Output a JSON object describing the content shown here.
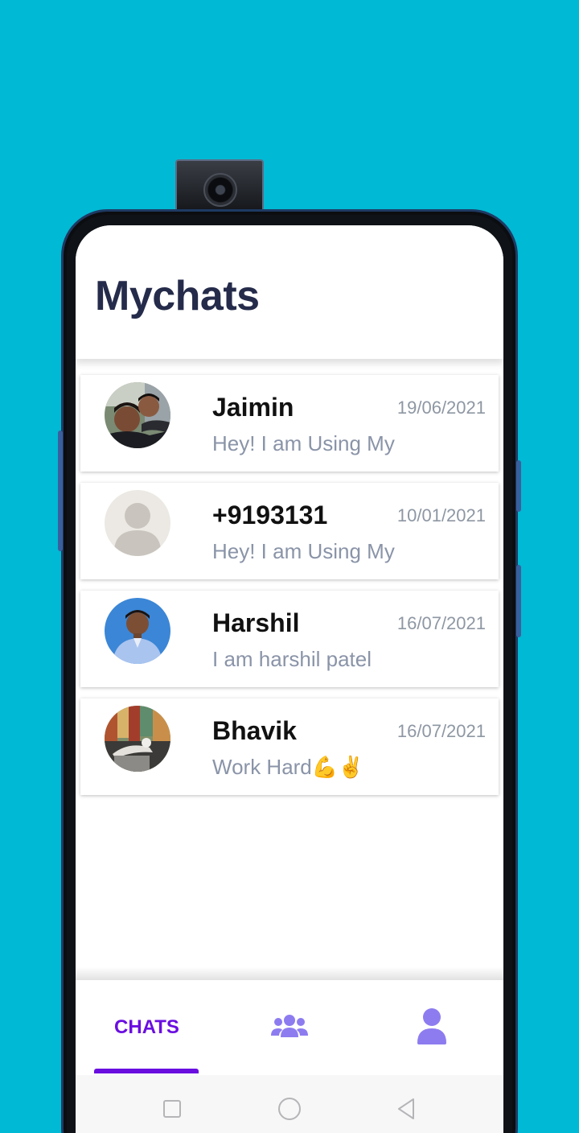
{
  "app": {
    "title": "Mychats"
  },
  "chats": [
    {
      "name": "Jaimin",
      "date": "19/06/2021",
      "message": "Hey! I am Using My"
    },
    {
      "name": "+9193131",
      "date": "10/01/2021",
      "message": "Hey! I am Using My"
    },
    {
      "name": "Harshil",
      "date": "16/07/2021",
      "message": "I am harshil patel"
    },
    {
      "name": "Bhavik",
      "date": "16/07/2021",
      "message": "Work Hard💪✌"
    }
  ],
  "tabs": {
    "chats_label": "CHATS",
    "groups_icon": "groups-icon",
    "profile_icon": "profile-icon"
  },
  "colors": {
    "background": "#00b9d4",
    "title": "#252b4a",
    "accent": "#6a0ee0",
    "icon_inactive": "#8d7cf0"
  }
}
